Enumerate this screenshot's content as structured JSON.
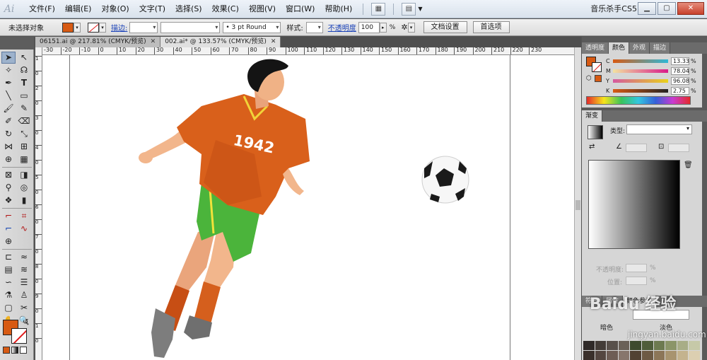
{
  "app": {
    "logo": "Ai",
    "workspace": "音乐杀手CS5"
  },
  "menu": [
    "文件(F)",
    "编辑(E)",
    "对象(O)",
    "文字(T)",
    "选择(S)",
    "效果(C)",
    "视图(V)",
    "窗口(W)",
    "帮助(H)"
  ],
  "control": {
    "selection": "未选择对象",
    "fill_color": "#d75a13",
    "stroke_link": "描边:",
    "brush": "3 pt Round",
    "style_label": "样式:",
    "opacity_link": "不透明度",
    "opacity_value": "100",
    "opacity_unit": "%",
    "doc_setup_button": "文档设置",
    "preferences_button": "首选项"
  },
  "tabs": [
    {
      "label": "06151.ai @ 217.81% (CMYK/预览)"
    },
    {
      "label": "002.ai* @ 133.57% (CMYK/预览)"
    }
  ],
  "ruler": {
    "h": [
      "-30",
      "-20",
      "-10",
      "0",
      "10",
      "20",
      "30",
      "40",
      "50",
      "60",
      "70",
      "80",
      "90",
      "100",
      "110",
      "120",
      "130",
      "140",
      "150",
      "160",
      "170",
      "180",
      "190",
      "200",
      "210",
      "220",
      "230"
    ],
    "v": [
      "1",
      "0",
      "2",
      "0",
      "3",
      "0",
      "4",
      "0",
      "5",
      "0",
      "6",
      "0",
      "7",
      "0",
      "8",
      "0",
      "9",
      "0",
      "1",
      "0"
    ]
  },
  "artwork": {
    "jersey_number": "1942"
  },
  "panel": {
    "tabs1": [
      "透明度",
      "颜色",
      "外观",
      "描边"
    ],
    "cmyk": [
      {
        "label": "C",
        "value": "13.33",
        "color": "#2fb8d6"
      },
      {
        "label": "M",
        "value": "78.04",
        "color": "#d91b8a"
      },
      {
        "label": "Y",
        "value": "96.08",
        "color": "#e9d21a"
      },
      {
        "label": "K",
        "value": "2.75",
        "color": "#333333"
      }
    ],
    "pct": "%",
    "gradient_tab": "渐变",
    "type_label": "类型:",
    "opacity_label": "不透明度:",
    "position_label": "位置:",
    "tabs2": [
      "符号",
      "属性",
      "颜色参考"
    ],
    "dark_label": "暗色",
    "light_label": "淡色"
  },
  "watermark": {
    "text": "Baidu 经验",
    "url": "jingyan.baidu.com"
  }
}
